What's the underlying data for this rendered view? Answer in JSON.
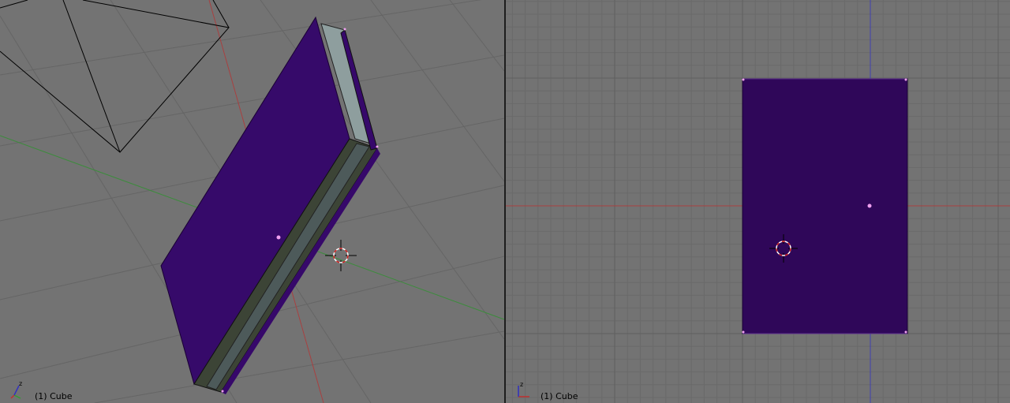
{
  "viewports": {
    "left": {
      "view": "perspective",
      "object_label": "(1) Cube",
      "gizmo_axis_label": "z"
    },
    "right": {
      "view": "orthographic",
      "object_label": "(1) Cube",
      "gizmo_axis_label": "z"
    }
  },
  "colors": {
    "background": "#737373",
    "grid_line": "#646464",
    "object_face": "#2f0759",
    "object_face_lit": "#3a0a78",
    "object_side_dark": "#3d4535",
    "object_side_light": "#8a9a9a",
    "axis_x": "#b04040",
    "axis_y": "#3c8c3c",
    "axis_z": "#4040b0",
    "vertex": "#f0a0f0"
  }
}
